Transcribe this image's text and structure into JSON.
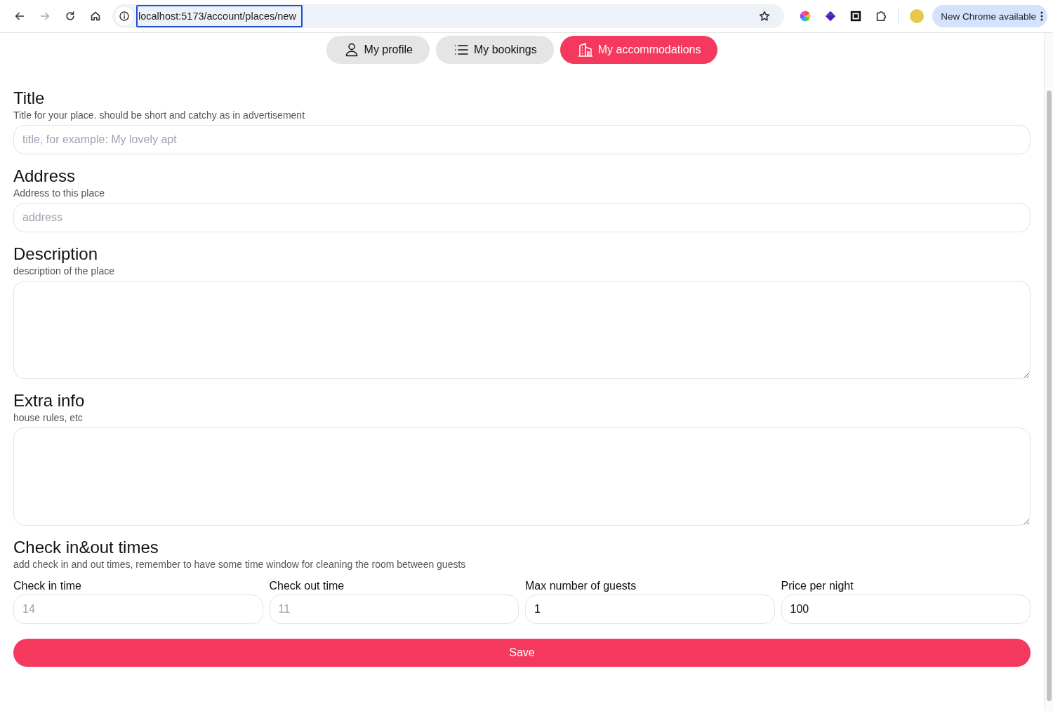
{
  "browser": {
    "url": "localhost:5173/account/places/new",
    "forward_disabled": true,
    "update_button": "New Chrome available"
  },
  "nav": [
    {
      "label": "My profile",
      "kind": "person",
      "selected": false
    },
    {
      "label": "My bookings",
      "kind": "list",
      "selected": false
    },
    {
      "label": "My accommodations",
      "kind": "building",
      "selected": true
    }
  ],
  "sections": [
    {
      "kind": "input",
      "title": "Title",
      "hint": "Title for your place. should be short and catchy as in advertisement",
      "placeholder": "title, for example: My lovely apt"
    },
    {
      "kind": "input",
      "title": "Address",
      "hint": "Address to this place",
      "placeholder": "address"
    },
    {
      "kind": "textarea",
      "title": "Description",
      "hint": "description of the place"
    },
    {
      "kind": "textarea",
      "title": "Extra info",
      "hint": "house rules, etc"
    },
    {
      "kind": "grid",
      "title": "Check in&out times",
      "hint": "add check in and out times, remember to have some time window for cleaning the room between guests",
      "fields": [
        {
          "label": "Check in time",
          "placeholder": "14"
        },
        {
          "label": "Check out time",
          "placeholder": "11"
        },
        {
          "label": "Max number of guests",
          "value": "1"
        },
        {
          "label": "Price per night",
          "value": "100"
        }
      ]
    }
  ],
  "save_button": "Save"
}
